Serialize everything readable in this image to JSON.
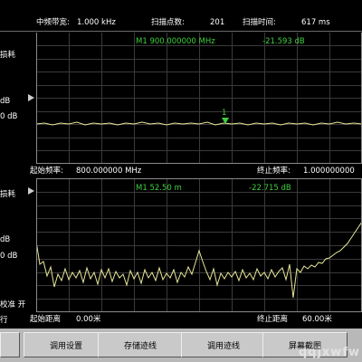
{
  "header": {
    "if_bw_label": "中频带宽:",
    "if_bw_value": "1.000 kHz",
    "points_label": "扫描点数:",
    "points_value": "201",
    "sweep_time_label": "扫描时间:",
    "sweep_time_value": "617 ms"
  },
  "trace1": {
    "side_label_a": "损耗",
    "side_label_b": "dB",
    "side_label_c": "0 dB",
    "marker_readout": "M1 900.000000 MHz",
    "marker_value": "-21.593 dB",
    "marker_tag": "1",
    "start_label": "起始频率:",
    "start_value": "800.000000 MHz",
    "stop_label": "终止频率:",
    "stop_value": "1.000000000"
  },
  "trace2": {
    "side_label_a": "损耗",
    "side_label_b": "dB",
    "side_label_c": "0 dB",
    "side_label_d": "校准 开",
    "side_label_e": "行",
    "marker_readout": "M1 52.50 m",
    "marker_value": "-22.715 dB",
    "start_label": "起始距离",
    "start_value": "0.00米",
    "stop_label": "终止距离",
    "stop_value": "60.00米"
  },
  "softkeys": [
    {
      "label": ""
    },
    {
      "label": "调用设置"
    },
    {
      "label": "存储迹线"
    },
    {
      "label": "调用迹线"
    },
    {
      "label": "屏幕截图"
    }
  ],
  "watermark": "qqjxwfw",
  "colors": {
    "trace": "#e8e89a",
    "marker": "#3ecf3e",
    "grid": "#3a3a3a"
  }
}
